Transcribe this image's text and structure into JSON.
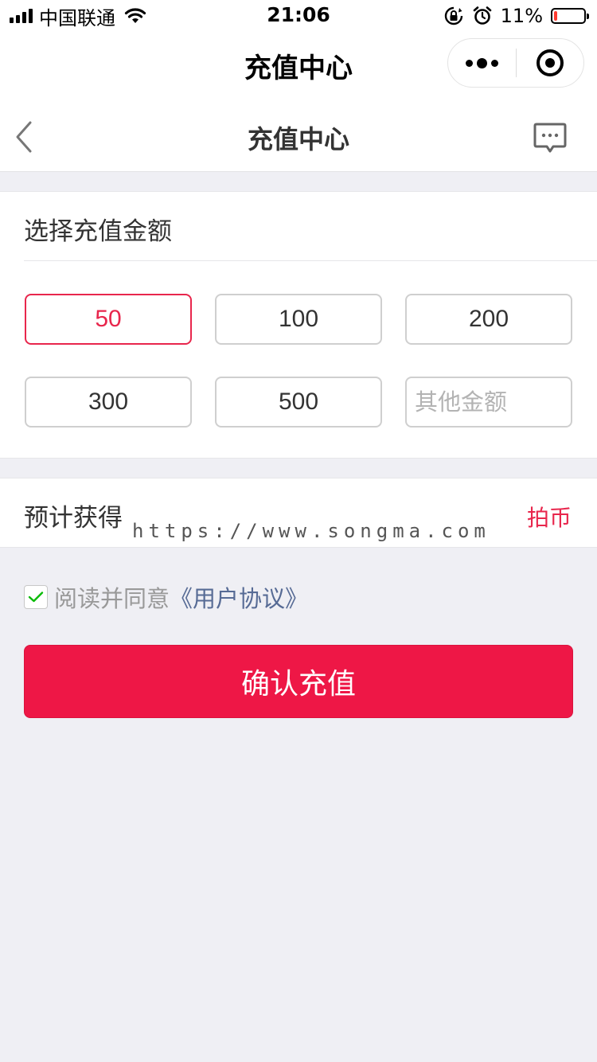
{
  "status_bar": {
    "carrier": "中国联通",
    "time": "21:06",
    "battery_percent": "11%",
    "battery_level": 0.11,
    "battery_color": "#ff3b30",
    "icons": [
      "signal-icon",
      "wifi-icon",
      "orientation-lock-icon",
      "alarm-icon",
      "battery-icon"
    ]
  },
  "mini_program": {
    "title": "充值中心",
    "icons": [
      "more-icon",
      "close-target-icon"
    ]
  },
  "header": {
    "title": "充值中心",
    "icons": [
      "back-icon",
      "message-icon"
    ]
  },
  "amount_section": {
    "title": "选择充值金额",
    "options": [
      {
        "label": "50",
        "selected": true
      },
      {
        "label": "100",
        "selected": false
      },
      {
        "label": "200",
        "selected": false
      },
      {
        "label": "300",
        "selected": false
      },
      {
        "label": "500",
        "selected": false
      }
    ],
    "other": {
      "placeholder": "其他金额",
      "value": ""
    }
  },
  "estimate": {
    "label": "预计获得",
    "unit": "拍币",
    "watermark": "https://www.songma.com"
  },
  "agreement": {
    "checked": true,
    "text": "阅读并同意",
    "link": "《用户协议》"
  },
  "confirm": {
    "label": "确认充值"
  },
  "colors": {
    "accent": "#e8264c",
    "button": "#ee1746",
    "link": "#576b95",
    "background": "#efeff4",
    "check": "#09bb07"
  }
}
